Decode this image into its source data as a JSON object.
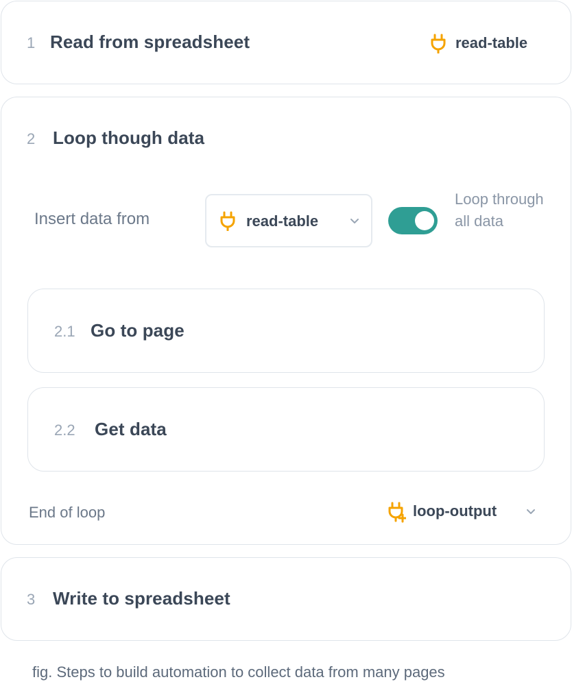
{
  "steps": [
    {
      "number": "1",
      "title": "Read from spreadsheet",
      "output_label": "read-table",
      "output_icon": "plug-icon"
    },
    {
      "number": "2",
      "title": "Loop though data",
      "insert_label": "Insert data from",
      "insert_select": {
        "value": "read-table",
        "icon": "plug-icon"
      },
      "toggle": {
        "on": true,
        "label": "Loop through all data",
        "color": "#2f9e94"
      },
      "substeps": [
        {
          "number": "2.1",
          "title": "Go to page"
        },
        {
          "number": "2.2",
          "title": "Get data"
        }
      ],
      "end_label": "End of loop",
      "end_output": {
        "value": "loop-output",
        "icon": "plug-add-icon"
      }
    },
    {
      "number": "3",
      "title": "Write to spreadsheet"
    }
  ],
  "caption": "fig. Steps to build automation to collect data from many pages",
  "colors": {
    "accent": "#f5a300",
    "toggle": "#2f9e94",
    "border": "#dfe4ea"
  }
}
